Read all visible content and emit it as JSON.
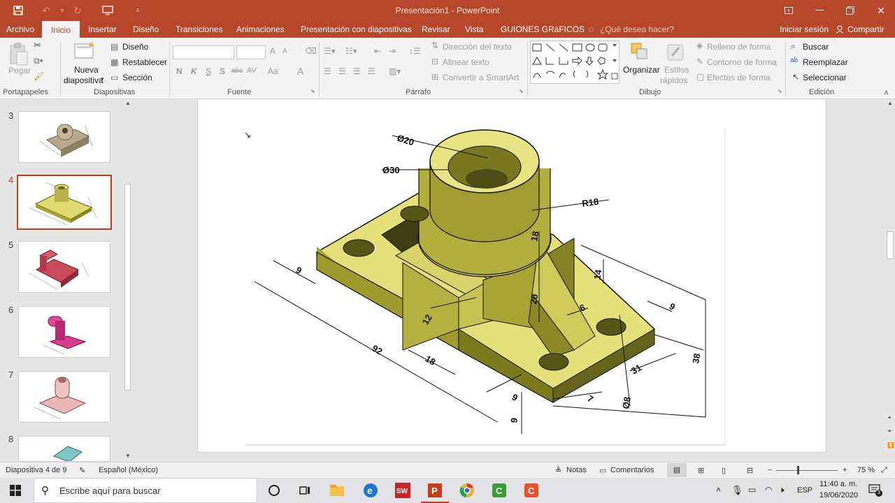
{
  "window": {
    "title": "Presentación1 - PowerPoint"
  },
  "tabs": [
    {
      "label": "Archivo"
    },
    {
      "label": "Inicio"
    },
    {
      "label": "Insertar"
    },
    {
      "label": "Diseño"
    },
    {
      "label": "Transiciones"
    },
    {
      "label": "Animaciones"
    },
    {
      "label": "Presentación con diapositivas"
    },
    {
      "label": "Revisar"
    },
    {
      "label": "Vista"
    },
    {
      "label": "GUIONES GRáFICOS"
    },
    {
      "label": "¿Qué desea hacer?"
    }
  ],
  "account": {
    "signin": "Iniciar sesión",
    "share": "Compartir"
  },
  "ribbon": {
    "clipboard": {
      "paste": "Pegar",
      "group": "Portapapeles"
    },
    "slides": {
      "new_line1": "Nueva",
      "new_line2": "diapositiva",
      "layout": "Diseño",
      "reset": "Restablecer",
      "section": "Sección",
      "group": "Diapositivas"
    },
    "font": {
      "group": "Fuente",
      "bold": "N",
      "italic": "K",
      "underline": "S",
      "shadow": "S",
      "strike": "abc",
      "spacing": "AV",
      "case": "Aa",
      "color": "A",
      "grow": "A",
      "shrink": "A"
    },
    "paragraph": {
      "text_direction": "Dirección del texto",
      "align_text": "Alinear texto",
      "smartart": "Convertir a SmartArt",
      "group": "Párrafo"
    },
    "drawing": {
      "arrange": "Organizar",
      "quick_styles_1": "Estilos",
      "quick_styles_2": "rápidos",
      "fill": "Relleno de forma",
      "outline": "Contorno de forma",
      "effects": "Efectos de forma",
      "group": "Dibujo"
    },
    "editing": {
      "find": "Buscar",
      "replace": "Reemplazar",
      "select": "Seleccionar",
      "group": "Edición"
    }
  },
  "slides_panel": {
    "numbers": [
      "3",
      "4",
      "5",
      "6",
      "7",
      "8"
    ],
    "selected": "4"
  },
  "drawing_dims": {
    "d20": "Ø20",
    "d30": "Ø30",
    "r18": "R18",
    "v9": "9",
    "v18": "18",
    "v14": "14",
    "v20": "20",
    "v6": "6",
    "v9b": "9",
    "v92": "92",
    "v12": "12",
    "v18b": "18",
    "v38": "38",
    "v31": "31",
    "v8": "Ø8",
    "v9c": "9",
    "v9d": "9",
    "v7": "7"
  },
  "status": {
    "slide": "Diapositiva 4 de 9",
    "language": "Español (México)",
    "notes": "Notas",
    "comments": "Comentarios",
    "zoom": "75 %"
  },
  "taskbar": {
    "search_placeholder": "Escribe aquí para buscar",
    "time": "11:40 a. m.",
    "date": "19/06/2020",
    "lang": "ESP",
    "notifications": "3"
  },
  "colors": {
    "accent": "#b7472a",
    "selection": "#c43e1c",
    "part_fill": "#e4e07a",
    "part_dark": "#7d7a1e"
  }
}
